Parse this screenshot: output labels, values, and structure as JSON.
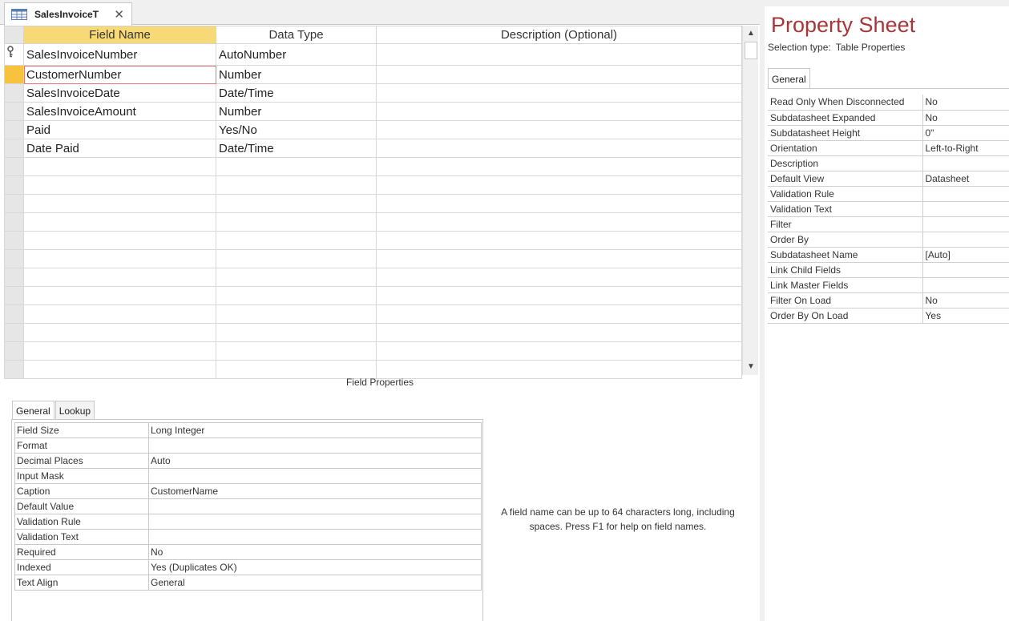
{
  "document_tab": {
    "title": "SalesInvoiceT",
    "close_glyph": "✕",
    "icon": "table-icon"
  },
  "grid": {
    "columns": [
      "Field Name",
      "Data Type",
      "Description (Optional)"
    ],
    "rows": [
      {
        "field": "SalesInvoiceNumber",
        "type": "AutoNumber",
        "description": "",
        "primary_key": true
      },
      {
        "field": "CustomerNumber",
        "type": "Number",
        "description": "",
        "current": true
      },
      {
        "field": "SalesInvoiceDate",
        "type": "Date/Time",
        "description": ""
      },
      {
        "field": "SalesInvoiceAmount",
        "type": "Number",
        "description": ""
      },
      {
        "field": "Paid",
        "type": "Yes/No",
        "description": ""
      },
      {
        "field": "Date Paid",
        "type": "Date/Time",
        "description": ""
      }
    ],
    "empty_rows": 12
  },
  "field_properties": {
    "section_label": "Field Properties",
    "tabs": [
      "General",
      "Lookup"
    ],
    "active_tab": "General",
    "rows": [
      {
        "label": "Field Size",
        "value": "Long Integer"
      },
      {
        "label": "Format",
        "value": ""
      },
      {
        "label": "Decimal Places",
        "value": "Auto"
      },
      {
        "label": "Input Mask",
        "value": ""
      },
      {
        "label": "Caption",
        "value": "CustomerName"
      },
      {
        "label": "Default Value",
        "value": ""
      },
      {
        "label": "Validation Rule",
        "value": ""
      },
      {
        "label": "Validation Text",
        "value": ""
      },
      {
        "label": "Required",
        "value": "No"
      },
      {
        "label": "Indexed",
        "value": "Yes (Duplicates OK)"
      },
      {
        "label": "Text Align",
        "value": "General"
      }
    ],
    "help_text": "A field name can be up to 64 characters long, including spaces. Press F1 for help on field names."
  },
  "property_sheet": {
    "title": "Property Sheet",
    "selection_type_label": "Selection type:",
    "selection_type_value": "Table Properties",
    "tab": "General",
    "rows": [
      {
        "label": "Read Only When Disconnected",
        "value": "No"
      },
      {
        "label": "Subdatasheet Expanded",
        "value": "No"
      },
      {
        "label": "Subdatasheet Height",
        "value": "0\""
      },
      {
        "label": "Orientation",
        "value": "Left-to-Right"
      },
      {
        "label": "Description",
        "value": ""
      },
      {
        "label": "Default View",
        "value": "Datasheet"
      },
      {
        "label": "Validation Rule",
        "value": ""
      },
      {
        "label": "Validation Text",
        "value": ""
      },
      {
        "label": "Filter",
        "value": ""
      },
      {
        "label": "Order By",
        "value": ""
      },
      {
        "label": "Subdatasheet Name",
        "value": "[Auto]"
      },
      {
        "label": "Link Child Fields",
        "value": ""
      },
      {
        "label": "Link Master Fields",
        "value": ""
      },
      {
        "label": "Filter On Load",
        "value": "No"
      },
      {
        "label": "Order By On Load",
        "value": "Yes"
      }
    ]
  },
  "colors": {
    "title_red": "#a4373a",
    "selected_header": "#f7d978",
    "current_row_selector": "#f7c23e",
    "active_cell_outline": "#e07a7a"
  }
}
